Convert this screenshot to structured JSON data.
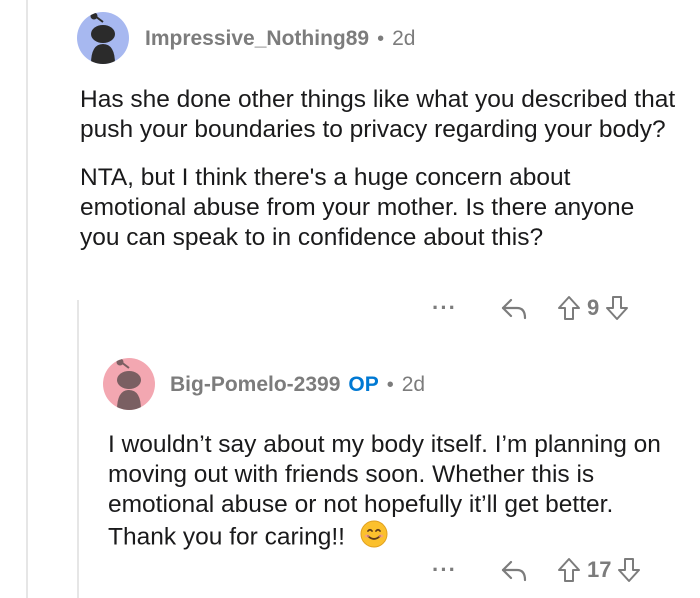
{
  "comments": [
    {
      "username": "Impressive_Nothing89",
      "separator": "•",
      "age": "2d",
      "paragraphs": [
        "Has she done other things like what you described that push your boundaries to privacy regarding your body?",
        "NTA, but I think there's a huge concern about emotional abuse from your mother. Is there anyone you can speak to in confidence about this?"
      ],
      "more": "···",
      "votes": "9",
      "avatar_color": "#a7b8f0"
    },
    {
      "username": "Big-Pomelo-2399",
      "op_badge": "OP",
      "separator": "•",
      "age": "2d",
      "paragraphs": [
        "I wouldn’t say about my body itself. I’m planning on moving out with friends soon. Whether this is emotional abuse or not hopefully it’ll get better. Thank you for caring!!"
      ],
      "emoji": "smiling-face-emoji",
      "more": "···",
      "votes": "17",
      "avatar_color": "#f3a7b1"
    }
  ],
  "colors": {
    "username": "#7c7c7c",
    "op": "#0079d3",
    "text": "#1a1a1b",
    "thread_line": "#e6e6e6"
  },
  "icons": [
    "snoo-avatar-icon",
    "reply-icon",
    "upvote-icon",
    "downvote-icon",
    "more-options-icon"
  ]
}
